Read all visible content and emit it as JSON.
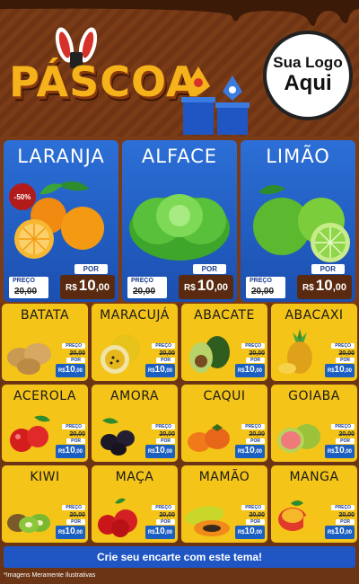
{
  "header": {
    "title": "PÁSCOA",
    "logo_line1": "Sua Logo",
    "logo_line2": "Aqui"
  },
  "featured": [
    {
      "name": "LARANJA",
      "badge": "-50%",
      "por_label": "POR",
      "preco_label": "PREÇO",
      "old_price": "20,00",
      "currency": "R$",
      "price_int": "10",
      "price_cents": ",00",
      "icon": "orange-fruit-icon"
    },
    {
      "name": "ALFACE",
      "por_label": "POR",
      "preco_label": "PREÇO",
      "old_price": "20,00",
      "currency": "R$",
      "price_int": "10",
      "price_cents": ",00",
      "icon": "lettuce-icon"
    },
    {
      "name": "LIMÃO",
      "por_label": "POR",
      "preco_label": "PREÇO",
      "old_price": "20,00",
      "currency": "R$",
      "price_int": "10",
      "price_cents": ",00",
      "icon": "lime-icon"
    }
  ],
  "products": [
    {
      "name": "BATATA",
      "preco_label": "PREÇO",
      "old_price": "20,00",
      "por_label": "POR",
      "currency": "R$",
      "price_int": "10",
      "price_cents": ",00",
      "icon": "potato-icon"
    },
    {
      "name": "MARACUJÁ",
      "preco_label": "PREÇO",
      "old_price": "20,00",
      "por_label": "POR",
      "currency": "R$",
      "price_int": "10",
      "price_cents": ",00",
      "icon": "passion-fruit-icon"
    },
    {
      "name": "ABACATE",
      "preco_label": "PREÇO",
      "old_price": "20,00",
      "por_label": "POR",
      "currency": "R$",
      "price_int": "10",
      "price_cents": ",00",
      "icon": "avocado-icon"
    },
    {
      "name": "ABACAXI",
      "preco_label": "PREÇO",
      "old_price": "20,00",
      "por_label": "POR",
      "currency": "R$",
      "price_int": "10",
      "price_cents": ",00",
      "icon": "pineapple-icon"
    },
    {
      "name": "ACEROLA",
      "preco_label": "PREÇO",
      "old_price": "20,00",
      "por_label": "POR",
      "currency": "R$",
      "price_int": "10",
      "price_cents": ",00",
      "icon": "acerola-icon"
    },
    {
      "name": "AMORA",
      "preco_label": "PREÇO",
      "old_price": "20,00",
      "por_label": "POR",
      "currency": "R$",
      "price_int": "10",
      "price_cents": ",00",
      "icon": "blackberry-icon"
    },
    {
      "name": "CAQUI",
      "preco_label": "PREÇO",
      "old_price": "20,00",
      "por_label": "POR",
      "currency": "R$",
      "price_int": "10",
      "price_cents": ",00",
      "icon": "persimmon-icon"
    },
    {
      "name": "GOIABA",
      "preco_label": "PREÇO",
      "old_price": "20,00",
      "por_label": "POR",
      "currency": "R$",
      "price_int": "10",
      "price_cents": ",00",
      "icon": "guava-icon"
    },
    {
      "name": "KIWI",
      "preco_label": "PREÇO",
      "old_price": "20,00",
      "por_label": "POR",
      "currency": "R$",
      "price_int": "10",
      "price_cents": ",00",
      "icon": "kiwi-icon"
    },
    {
      "name": "MAÇA",
      "preco_label": "PREÇO",
      "old_price": "20,00",
      "por_label": "POR",
      "currency": "R$",
      "price_int": "10",
      "price_cents": ",00",
      "icon": "apple-icon"
    },
    {
      "name": "MAMÃO",
      "preco_label": "PREÇO",
      "old_price": "20,00",
      "por_label": "POR",
      "currency": "R$",
      "price_int": "10",
      "price_cents": ",00",
      "icon": "papaya-icon"
    },
    {
      "name": "MANGA",
      "preco_label": "PREÇO",
      "old_price": "20,00",
      "por_label": "POR",
      "currency": "R$",
      "price_int": "10",
      "price_cents": ",00",
      "icon": "mango-icon"
    }
  ],
  "footer": {
    "cta": "Crie seu encarte com este tema!",
    "note": "*Imagens Meramente Ilustrativas"
  },
  "colors": {
    "brown": "#6b3415",
    "blue": "#1f56c4",
    "yellow": "#f4c418",
    "title_gold": "#f6b21a"
  }
}
